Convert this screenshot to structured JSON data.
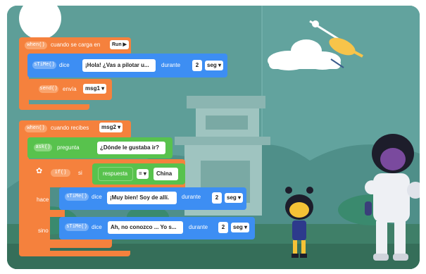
{
  "colors": {
    "orange": "#f5813d",
    "blue": "#3d8ef3",
    "green": "#58c24d",
    "teal": "#3fb6a8",
    "sky": "#5e9e98"
  },
  "block1": {
    "hat": "when()",
    "text": "cuando se carga en",
    "run_label": "Run ▶",
    "say_pill": "sTiMe()",
    "say_word": "dice",
    "say_value": "¡Hola! ¿Vas a pilotar u...",
    "durante": "durante",
    "seconds": "2",
    "seg": "seg ▾",
    "send_pill": "send()",
    "send_word": "envía",
    "send_value": "msg1 ▾"
  },
  "block2": {
    "hat": "when()",
    "text": "cuando recibes",
    "msg_value": "msg2 ▾",
    "ask_pill": "ask()",
    "ask_word": "pregunta",
    "ask_value": "¿Dónde le gustaba ir?",
    "if_pill": "if()",
    "if_word": "si",
    "answer_word": "respuesta",
    "op_value": "= ▾",
    "compare_value": "China",
    "hace": "hace",
    "sino": "sino",
    "say1_pill": "sTiMe()",
    "say1_word": "dice",
    "say1_value": "¡Muy bien! Soy de allí.",
    "say1_durante": "durante",
    "say1_seconds": "2",
    "say1_seg": "seg ▾",
    "say2_pill": "sTiMe()",
    "say2_word": "dice",
    "say2_value": "Ah, no conozco ... Yo s...",
    "say2_durante": "durante",
    "say2_seconds": "2",
    "say2_seg": "seg ▾"
  }
}
